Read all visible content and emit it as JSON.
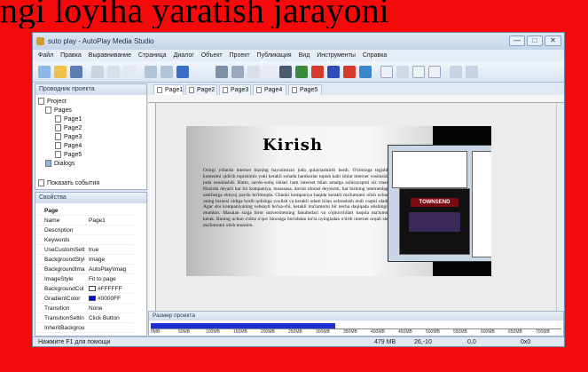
{
  "caption": "ngi loyiha yaratish jarayoni",
  "window": {
    "title": "suto play - AutoPlay Media Studio",
    "min_label": "—",
    "max_label": "□",
    "close_label": "✕"
  },
  "menu": [
    "Файл",
    "Правка",
    "Выравнивание",
    "Страница",
    "Диалог",
    "Объект",
    "Проект",
    "Публикация",
    "Вид",
    "Инструменты",
    "Справка"
  ],
  "toolbar_icons": [
    "wand-icon",
    "open-folder-icon",
    "save-icon",
    "cut-icon",
    "copy-icon",
    "paste-icon",
    "undo-icon",
    "redo-icon",
    "preview-icon",
    "button-icon",
    "label-icon",
    "paragraph-icon",
    "image-icon",
    "flash-icon",
    "video-icon",
    "web-icon",
    "pdf-icon",
    "xbutton-icon",
    "input-icon",
    "checkbox-icon",
    "radio-icon",
    "combobox-icon",
    "listbox-icon",
    "grid-icon",
    "tree-icon"
  ],
  "project_panel": {
    "title": "Проводник проекта",
    "root": "Project",
    "pages": "Pages",
    "page_items": [
      "Page1",
      "Page2",
      "Page3",
      "Page4",
      "Page5"
    ],
    "dialogs": "Dialogs",
    "show_events": "Показать события"
  },
  "props_panel": {
    "title": "Свойства",
    "section": "Page",
    "rows": [
      {
        "k": "Name",
        "v": "Page1"
      },
      {
        "k": "Description",
        "v": ""
      },
      {
        "k": "Keywords",
        "v": ""
      },
      {
        "k": "UseCustomSett",
        "v": "true"
      },
      {
        "k": "BackgroundStyl",
        "v": "Image"
      },
      {
        "k": "BackgroundIma",
        "v": "AutoPlay\\Imag"
      },
      {
        "k": "ImageStyle",
        "v": "Fit to page"
      },
      {
        "k": "BackgroundCol",
        "v": "#FFFFFF"
      },
      {
        "k": "GradientColor",
        "v": "#0000FF"
      },
      {
        "k": "Transition",
        "v": "None"
      },
      {
        "k": "TransitionSettin",
        "v": "Click Button"
      },
      {
        "k": "InheritBackgrou",
        "v": ""
      }
    ]
  },
  "tabs": [
    "Page1",
    "Page2",
    "Page3",
    "Page4",
    "Page5"
  ],
  "slide": {
    "title": "Kirish",
    "text": "Oxirgi yillarda internet bizning hayotimizni juda qulaylashtirib berdi. O'zimizga tegishli kontentni qidirib topishimiz yoki kerakli sohada hamkorlar topish kabi ishlar internet vositasida juda osonlashdi. Hatto, savdo-sotiq ishlari ham internet bilan amalga oshirayapmi siz rmas. Hozirda deyarli har bir kompaniya, muassasa, davlat idorasi deysizmi, har birining internetdagi sahifasiga ehtiyoj paydo bo'lmoqda. Chunki kompaniya haqida kerakli ma'lumotni olish uchun uning biznesi oldiga borib qolishga yoxlish va kerakli odam bilan uchrashish endi vaqtni oladi. Agar shu kompaniyaning vebsayti bo'lsa-chi, kerakli ma'lumotni bir necha daqiqada olishingiz mumkin. Masalan sizga biror universitetning fakultetlari va o'qituvchilari haqida ma'lumot kerak. Buning uchun o'zbiz o'quv binosiga borishdan ko'ra uyingizdan o'tirib internet orqali shu ma'lumotni olish mumkin.",
    "screenshot_label": "TOWNSEND"
  },
  "bottom_panel": {
    "title": "Размер проекта",
    "scale": [
      "0MB",
      "50MB",
      "100MB",
      "150MB",
      "200MB",
      "250MB",
      "300MB",
      "350MB",
      "400MB",
      "450MB",
      "500MB",
      "550MB",
      "600MB",
      "650MB",
      "700MB"
    ],
    "fill": 0.45
  },
  "status": {
    "help": "Нажмите F1 для помощи",
    "size": "479 MB",
    "coords": "26,-10",
    "pos": "0,0",
    "dims": "0x0"
  },
  "colors": {
    "bg": "#f40a0a",
    "accent": "#1b2ed0",
    "gradient_swatch": "#0000FF",
    "white_swatch": "#FFFFFF"
  }
}
